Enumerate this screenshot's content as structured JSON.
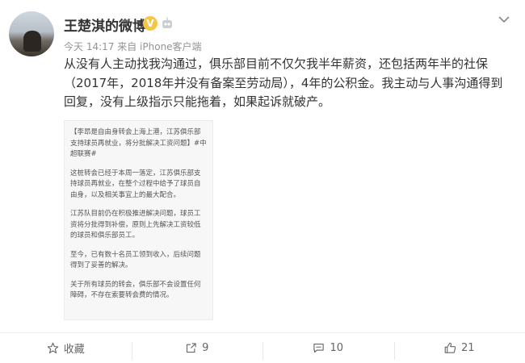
{
  "post": {
    "author": "王楚淇的微博",
    "verified_badge": "V",
    "time": "今天 14:17",
    "source": "来自 iPhone客户端",
    "content": "从没有人主动找我沟通过，俱乐部目前不仅欠我半年薪资，还包括两年半的社保（2017年，2018年并没有备案至劳动局），4年的公积金。我主动与人事沟通得到回复，没有上级指示只能拖着，如果起诉就破产。"
  },
  "attached_image": {
    "paragraphs": [
      "【李昂是自由身转会上海上港，江苏俱乐部支持球员再就业，将分批解决工资问题】#中超联赛#",
      "这桩转会已经于本周一落定，江苏俱乐部支持球员再就业，在整个过程中给予了球员自由身，以及相关事宜上的最大配合。",
      "江苏队目前仍在积极推进解决问题，球员工资将分批得到补偿，原则上先解决工资较低的球员和俱乐部员工。",
      "至今，已有数十名员工领到收入，后续问题得到了妥善的解决。",
      "关于所有球员的转会，俱乐部不会设置任何障碍，不存在索要转会费的情况。"
    ]
  },
  "actions": {
    "favorite": "收藏",
    "repost_count": "9",
    "comment_count": "10",
    "like_count": "21"
  },
  "icons": [
    "more-chevron-icon",
    "robot-icon",
    "star-icon",
    "share-icon",
    "comment-icon",
    "thumb-up-icon"
  ],
  "colors": {
    "verified": "#f6c645",
    "text": "#333333",
    "meta": "#939393"
  }
}
